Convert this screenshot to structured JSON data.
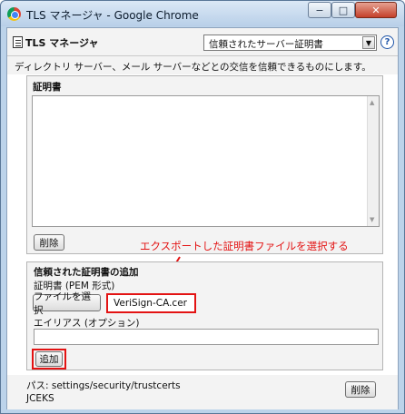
{
  "window": {
    "title": "TLS マネージャ - Google Chrome",
    "min_glyph": "−",
    "max_glyph": "□",
    "close_glyph": "✕"
  },
  "header": {
    "title": "TLS マネージャ",
    "dropdown_value": "信頼されたサーバー証明書",
    "dropdown_arrow": "▼",
    "help_glyph": "?"
  },
  "description": "ディレクトリ サーバー、メール サーバーなどとの交信を信頼できるものにします。",
  "certificates": {
    "title": "証明書",
    "items": [],
    "delete_label": "削除"
  },
  "annotation": "エクスポートした証明書ファイルを選択する",
  "add_section": {
    "title": "信頼された証明書の追加",
    "pem_label": "証明書 (PEM 形式)",
    "choose_file_label": "ファイルを選択",
    "file_name": "VeriSign-CA.cer",
    "alias_label": "エイリアス (オプション)",
    "alias_value": "",
    "add_label": "追加"
  },
  "footer": {
    "path": "パス: settings/security/trustcerts",
    "type": "JCEKS",
    "delete_label": "削除"
  },
  "colors": {
    "highlight": "#e31313"
  },
  "icons": [
    "chrome-icon",
    "certificate-icon",
    "help-icon",
    "chevron-down-icon",
    "arrow-icon"
  ]
}
